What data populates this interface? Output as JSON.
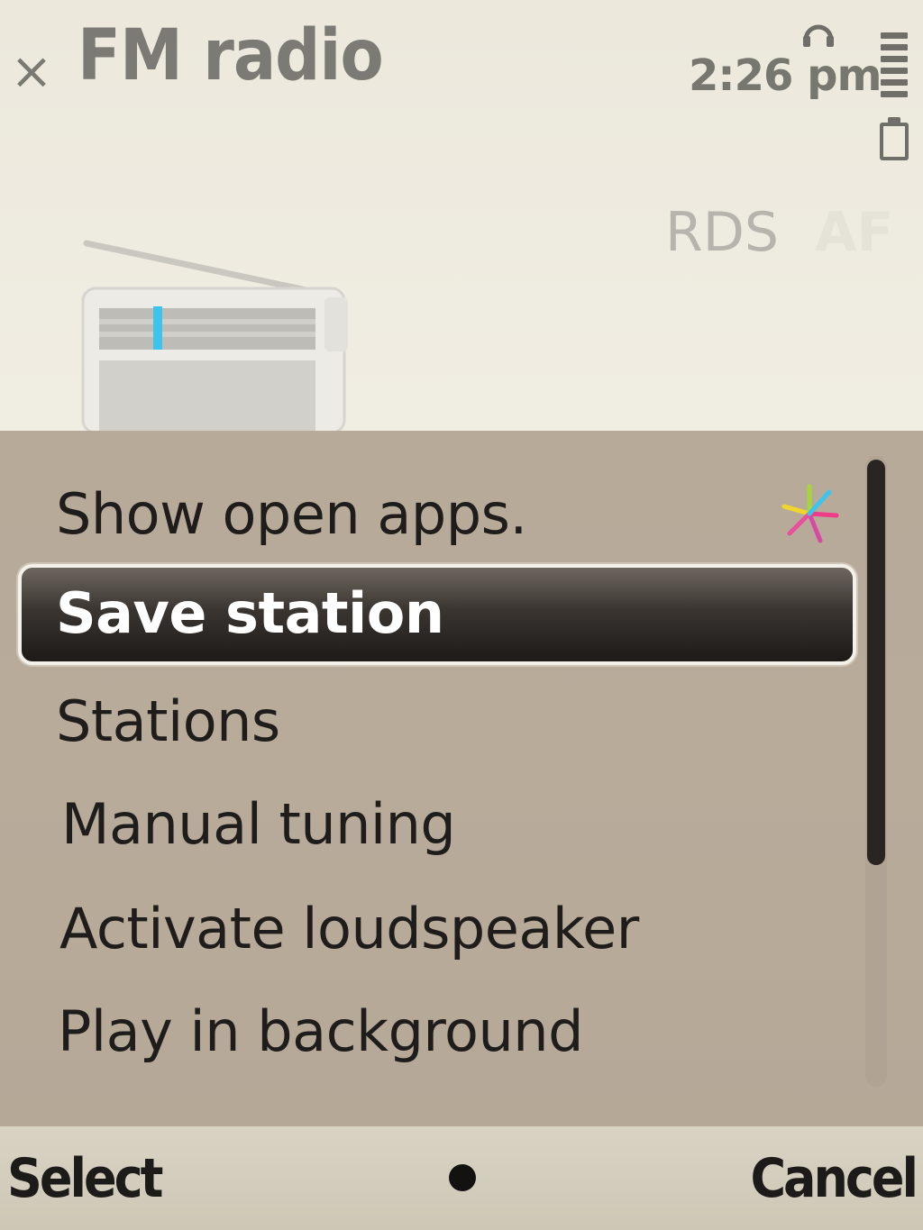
{
  "header": {
    "title": "FM radio",
    "time": "2:26 pm",
    "close_glyph": "×",
    "icons": [
      "close-icon",
      "headset-icon",
      "battery-icon",
      "signal-icon"
    ]
  },
  "indicators": {
    "rds": "RDS",
    "af": "AF"
  },
  "menu": {
    "items": [
      {
        "label": "Show open apps.",
        "icon": "open-apps-icon"
      },
      {
        "label": "Save station",
        "selected": true
      },
      {
        "label": "Stations"
      },
      {
        "label": "Manual tuning"
      },
      {
        "label": "Activate loudspeaker"
      },
      {
        "label": "Play in background"
      }
    ]
  },
  "softkeys": {
    "left": "Select",
    "right": "Cancel"
  },
  "colors": {
    "menu_bg": "#b7aa99",
    "highlight": "#2a2522",
    "accent_blue": "#3fc3ea"
  }
}
